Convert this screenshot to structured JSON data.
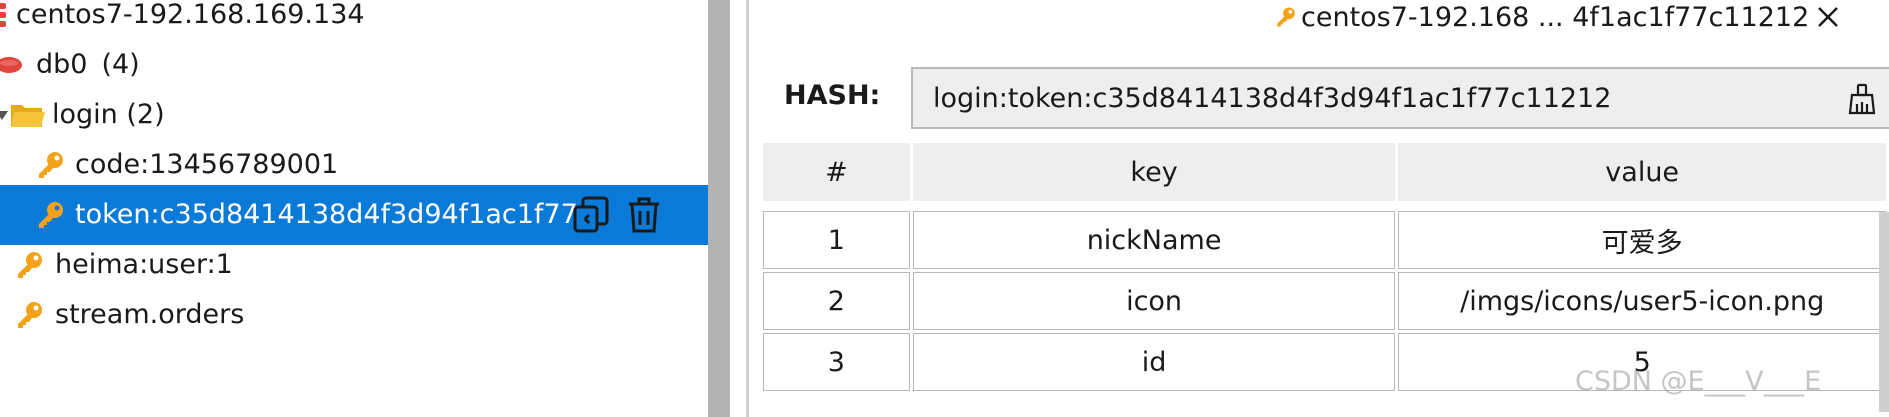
{
  "tree": {
    "connection": {
      "label": "centos7-192.168.169.134",
      "icon": "database-stack-icon"
    },
    "database": {
      "label": "db0",
      "count": "(4)",
      "icon": "database-icon"
    },
    "folder": {
      "label": "login (2)",
      "icon": "folder-open-icon"
    },
    "keys": [
      {
        "label": "code:13456789001",
        "icon": "key-icon"
      },
      {
        "label": "token:c35d8414138d4f3d94f1ac1f77",
        "icon": "key-icon",
        "selected": true
      }
    ],
    "root_keys": [
      {
        "label": "heima:user:1",
        "icon": "key-icon"
      },
      {
        "label": "stream.orders",
        "icon": "key-icon"
      }
    ],
    "row_actions": {
      "copy": "copy-icon",
      "delete": "trash-icon"
    }
  },
  "tab": {
    "title": "centos7-192.168 ... 4f1ac1f77c11212",
    "icon": "key-icon",
    "close": "close-icon"
  },
  "detail": {
    "type_label": "HASH:",
    "key_name": "login:token:c35d8414138d4f3d94f1ac1f77c11212",
    "clean_icon": "broom-icon"
  },
  "table": {
    "headers": [
      "#",
      "key",
      "value"
    ],
    "rows": [
      {
        "idx": "1",
        "key": "nickName",
        "value": "可爱多"
      },
      {
        "idx": "2",
        "key": "icon",
        "value": "/imgs/icons/user5-icon.png"
      },
      {
        "idx": "3",
        "key": "id",
        "value": "5"
      }
    ]
  },
  "watermark": "CSDN @E___V___E",
  "colors": {
    "selection": "#0a7ad9",
    "key_icon": "#f5a21b",
    "folder": "#f6c43b",
    "db": "#e0443d"
  }
}
